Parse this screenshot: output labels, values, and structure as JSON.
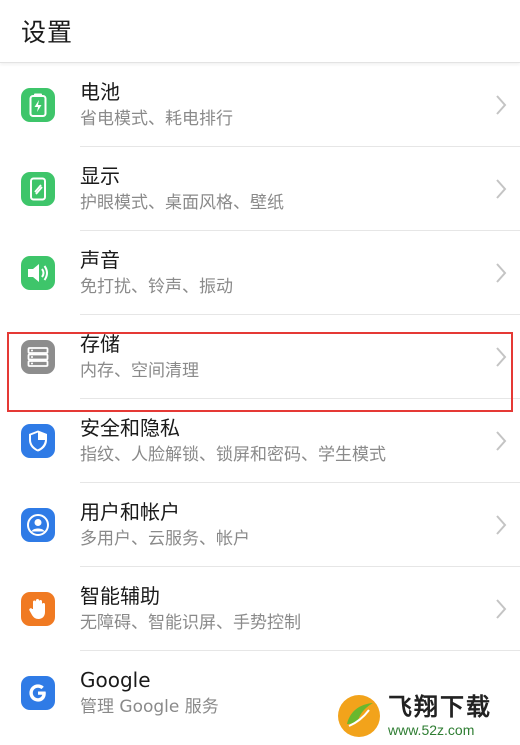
{
  "header": {
    "title": "设置"
  },
  "items": [
    {
      "label": "电池",
      "sub": "省电模式、耗电排行",
      "icon": "battery-icon",
      "color": "#3ec56a"
    },
    {
      "label": "显示",
      "sub": "护眼模式、桌面风格、壁纸",
      "icon": "display-icon",
      "color": "#3ec56a"
    },
    {
      "label": "声音",
      "sub": "免打扰、铃声、振动",
      "icon": "speaker-icon",
      "color": "#3ec56a"
    },
    {
      "label": "存储",
      "sub": "内存、空间清理",
      "icon": "storage-icon",
      "color": "#8d8d8d",
      "highlighted": true
    },
    {
      "label": "安全和隐私",
      "sub": "指纹、人脸解锁、锁屏和密码、学生模式",
      "icon": "shield-icon",
      "color": "#2f7be6"
    },
    {
      "label": "用户和帐户",
      "sub": "多用户、云服务、帐户",
      "icon": "user-icon",
      "color": "#2f7be6"
    },
    {
      "label": "智能辅助",
      "sub": "无障碍、智能识屏、手势控制",
      "icon": "hand-icon",
      "color": "#f07a22"
    },
    {
      "label": "Google",
      "sub": "管理 Google 服务",
      "icon": "google-icon",
      "color": "#2f7be6"
    }
  ],
  "highlight_color": "#e53935",
  "watermark": {
    "name": "飞翔下载",
    "url": "www.52z.com"
  }
}
